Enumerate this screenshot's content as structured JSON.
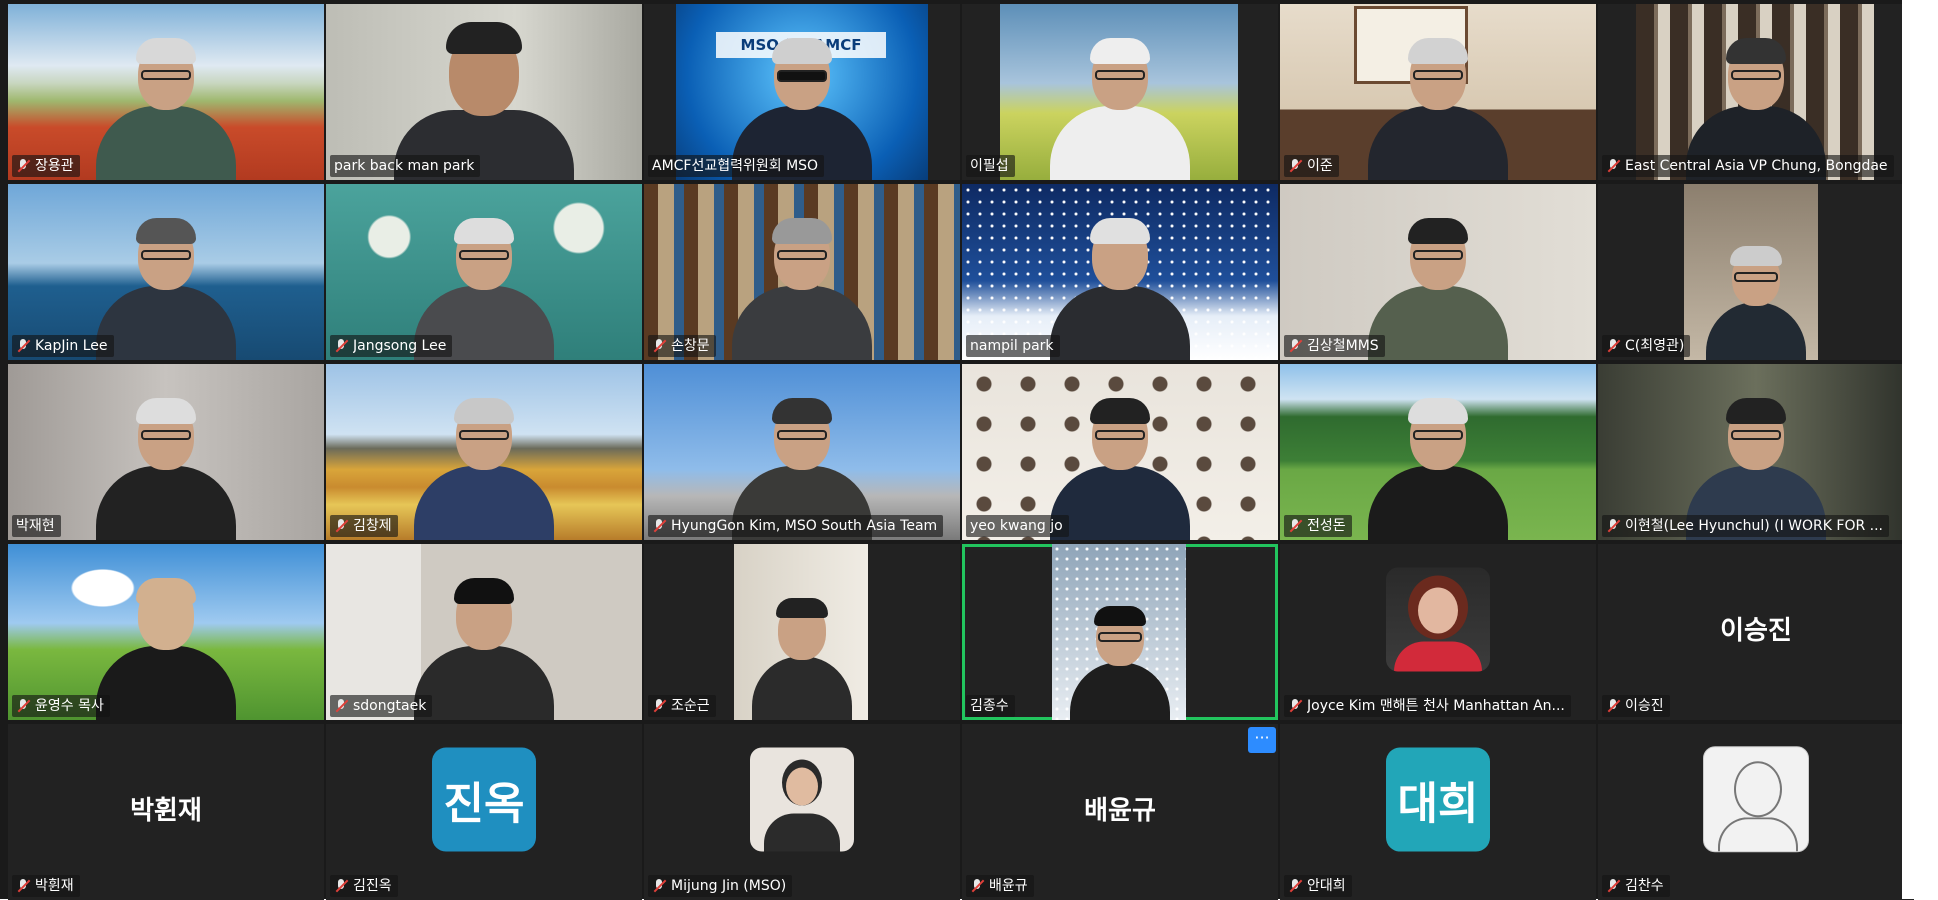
{
  "participants": [
    {
      "name": "장용관"
    },
    {
      "name": "park back man park"
    },
    {
      "name": "AMCF선교협력위원회 MSO",
      "backdrop_text": "MSO for AMCF"
    },
    {
      "name": "이필섭"
    },
    {
      "name": "이준"
    },
    {
      "name": "East Central Asia VP Chung, Bongdae"
    },
    {
      "name": "KapJin Lee"
    },
    {
      "name": "Jangsong Lee"
    },
    {
      "name": "손창문"
    },
    {
      "name": "nampil park"
    },
    {
      "name": "김상철MMS"
    },
    {
      "name": "C(최영관)"
    },
    {
      "name": "박재현"
    },
    {
      "name": "김창제"
    },
    {
      "name": "HyungGon Kim, MSO South Asia Team"
    },
    {
      "name": "yeo kwang jo"
    },
    {
      "name": "전성돈"
    },
    {
      "name": "이현철(Lee Hyunchul) (I WORK FOR ..."
    },
    {
      "name": "윤영수 목사"
    },
    {
      "name": "sdongtaek"
    },
    {
      "name": "조순근"
    },
    {
      "name": "김종수"
    },
    {
      "name": "Joyce Kim 맨해튼 천사 Manhattan An..."
    },
    {
      "name": "이승진",
      "display": "이승진"
    },
    {
      "name": "박휜재",
      "display": "박휜재"
    },
    {
      "name": "김진옥",
      "avatar_text": "진옥"
    },
    {
      "name": "Mijung Jin (MSO)"
    },
    {
      "name": "배윤규",
      "display": "배윤규"
    },
    {
      "name": "안대희",
      "avatar_text": "대희"
    },
    {
      "name": "김찬수"
    }
  ],
  "more_button": "···",
  "colors": {
    "active_speaker": "#22c55e",
    "avatar_bg": "#1f8fc0",
    "muted_icon": "#e0403a",
    "more_button": "#2d8cff"
  }
}
